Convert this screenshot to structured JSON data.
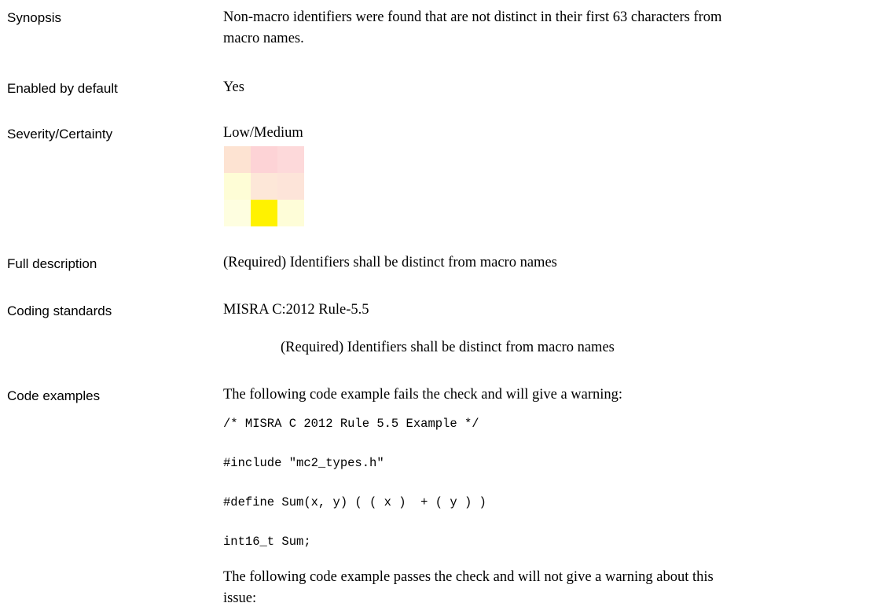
{
  "rows": {
    "synopsis": {
      "label": "Synopsis",
      "line1": "Non-macro identifiers were found that are not distinct in their first 63 characters from",
      "line2": "macro names."
    },
    "enabled": {
      "label": "Enabled by default",
      "value": "Yes"
    },
    "severity": {
      "label": "Severity/Certainty",
      "value": "Low/Medium",
      "matrix_colors": [
        [
          "#fde3d2",
          "#fdd3d6",
          "#fdd9da"
        ],
        [
          "#fefdd6",
          "#fde7d8",
          "#fde4d9"
        ],
        [
          "#fefee0",
          "#fff200",
          "#fefdd8"
        ]
      ]
    },
    "full_description": {
      "label": "Full description",
      "value": "(Required) Identifiers shall be distinct from macro names"
    },
    "coding_standards": {
      "label": "Coding standards",
      "standard": "MISRA C:2012 Rule-5.5",
      "detail": "(Required) Identifiers shall be distinct from macro names"
    },
    "code_examples": {
      "label": "Code examples",
      "fail_intro": "The following code example fails the check and will give a warning:",
      "code": [
        "/* MISRA C 2012 Rule 5.5 Example */",
        "#include \"mc2_types.h\"",
        "#define Sum(x, y) ( ( x )  + ( y ) )",
        "int16_t Sum;"
      ],
      "pass_intro_line1": "The following code example passes the check and will not give a warning about this",
      "pass_intro_line2": "issue:"
    }
  }
}
